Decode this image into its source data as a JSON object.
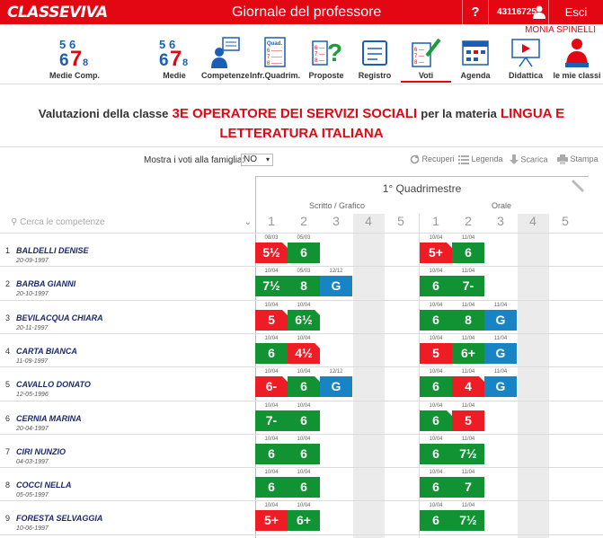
{
  "header": {
    "logo": "CLASSEVIVA",
    "title": "Giornale del professore",
    "help": "?",
    "user_id": "43116725",
    "logout": "Esci",
    "user_name": "MONIA SPINELLI"
  },
  "nav": [
    {
      "label": "Medie Comp.",
      "icon": "digits-icon"
    },
    {
      "label": "Medie",
      "icon": "digits-icon"
    },
    {
      "label": "Competenze",
      "icon": "competence-icon"
    },
    {
      "label": "Infr.Quadrim.",
      "icon": "report-icon"
    },
    {
      "label": "Proposte",
      "icon": "question-icon"
    },
    {
      "label": "Registro",
      "icon": "register-icon"
    },
    {
      "label": "Voti",
      "icon": "grades-icon"
    },
    {
      "label": "Agenda",
      "icon": "calendar-icon"
    },
    {
      "label": "Didattica",
      "icon": "board-icon"
    },
    {
      "label": "le mie classi",
      "icon": "teacher-icon"
    }
  ],
  "heading": {
    "prefix": "Valutazioni della classe",
    "class_name": "3E OPERATORE DEI SERVIZI SOCIALI",
    "middle": "per la materia",
    "subject": "LINGUA E LETTERATURA ITALIANA"
  },
  "toolbar": {
    "family_label": "Mostra i voti alla famiglia:",
    "family_value": "NO",
    "recuperi": "Recuperi",
    "legenda": "Legenda",
    "scarica": "Scarica",
    "stampa": "Stampa"
  },
  "grid": {
    "period": "1° Quadrimestre",
    "search_placeholder": "Cerca le competenze",
    "group_written": "Scritto / Grafico",
    "group_oral": "Orale",
    "columns": [
      "1",
      "2",
      "3",
      "4",
      "5"
    ],
    "colors": {
      "green": "#119233",
      "red": "#ee1c25",
      "blue": "#1884c4"
    }
  },
  "students": [
    {
      "num": "1",
      "name": "BALDELLI DENISE",
      "birth": "20-09-1997",
      "written": [
        {
          "d": "08/03",
          "v": "5½",
          "c": "red",
          "m": true
        },
        {
          "d": "05/03",
          "v": "6",
          "c": "green"
        }
      ],
      "oral": [
        {
          "d": "10/04",
          "v": "5+",
          "c": "red",
          "m": true
        },
        {
          "d": "11/04",
          "v": "6",
          "c": "green"
        }
      ]
    },
    {
      "num": "2",
      "name": "BARBA GIANNI",
      "birth": "20-10-1997",
      "written": [
        {
          "d": "10/04",
          "v": "7½",
          "c": "green"
        },
        {
          "d": "05/03",
          "v": "8",
          "c": "green"
        },
        {
          "d": "12/12",
          "v": "G",
          "c": "blue"
        }
      ],
      "oral": [
        {
          "d": "10/04",
          "v": "6",
          "c": "green"
        },
        {
          "d": "11/04",
          "v": "7-",
          "c": "green"
        }
      ]
    },
    {
      "num": "3",
      "name": "BEVILACQUA CHIARA",
      "birth": "20-11-1997",
      "written": [
        {
          "d": "10/04",
          "v": "5",
          "c": "red",
          "m": true
        },
        {
          "d": "10/04",
          "v": "6½",
          "c": "green",
          "m": true
        }
      ],
      "oral": [
        {
          "d": "10/04",
          "v": "6",
          "c": "green"
        },
        {
          "d": "11/04",
          "v": "8",
          "c": "green"
        },
        {
          "d": "11/04",
          "v": "G",
          "c": "blue"
        }
      ]
    },
    {
      "num": "4",
      "name": "CARTA BIANCA",
      "birth": "11-09-1997",
      "written": [
        {
          "d": "10/04",
          "v": "6",
          "c": "green"
        },
        {
          "d": "10/04",
          "v": "4½",
          "c": "red",
          "m": true
        }
      ],
      "oral": [
        {
          "d": "10/04",
          "v": "5",
          "c": "red"
        },
        {
          "d": "11/04",
          "v": "6+",
          "c": "green"
        },
        {
          "d": "11/04",
          "v": "G",
          "c": "blue"
        }
      ]
    },
    {
      "num": "5",
      "name": "CAVALLO DONATO",
      "birth": "12-05-1996",
      "written": [
        {
          "d": "10/04",
          "v": "6-",
          "c": "red",
          "m": true
        },
        {
          "d": "10/04",
          "v": "6",
          "c": "green",
          "m": true
        },
        {
          "d": "12/12",
          "v": "G",
          "c": "blue"
        }
      ],
      "oral": [
        {
          "d": "10/04",
          "v": "6",
          "c": "green"
        },
        {
          "d": "11/04",
          "v": "4",
          "c": "red",
          "m": true
        },
        {
          "d": "11/04",
          "v": "G",
          "c": "blue"
        }
      ]
    },
    {
      "num": "6",
      "name": "CERNIA MARINA",
      "birth": "20-04-1997",
      "written": [
        {
          "d": "10/04",
          "v": "7-",
          "c": "green"
        },
        {
          "d": "10/04",
          "v": "6",
          "c": "green"
        }
      ],
      "oral": [
        {
          "d": "10/04",
          "v": "6",
          "c": "green",
          "m": true
        },
        {
          "d": "11/04",
          "v": "5",
          "c": "red"
        }
      ]
    },
    {
      "num": "7",
      "name": "CIRI NUNZIO",
      "birth": "04-03-1997",
      "written": [
        {
          "d": "10/04",
          "v": "6",
          "c": "green"
        },
        {
          "d": "10/04",
          "v": "6",
          "c": "green"
        }
      ],
      "oral": [
        {
          "d": "10/04",
          "v": "6",
          "c": "green"
        },
        {
          "d": "11/04",
          "v": "7½",
          "c": "green"
        }
      ]
    },
    {
      "num": "8",
      "name": "COCCI NELLA",
      "birth": "05-05-1997",
      "written": [
        {
          "d": "10/04",
          "v": "6",
          "c": "green"
        },
        {
          "d": "10/04",
          "v": "6",
          "c": "green"
        }
      ],
      "oral": [
        {
          "d": "10/04",
          "v": "6",
          "c": "green"
        },
        {
          "d": "11/04",
          "v": "7",
          "c": "green"
        }
      ]
    },
    {
      "num": "9",
      "name": "FORESTA SELVAGGIA",
      "birth": "10-06-1997",
      "written": [
        {
          "d": "10/04",
          "v": "5+",
          "c": "red"
        },
        {
          "d": "10/04",
          "v": "6+",
          "c": "green"
        }
      ],
      "oral": [
        {
          "d": "10/04",
          "v": "6",
          "c": "green"
        },
        {
          "d": "11/04",
          "v": "7½",
          "c": "green"
        }
      ]
    }
  ]
}
